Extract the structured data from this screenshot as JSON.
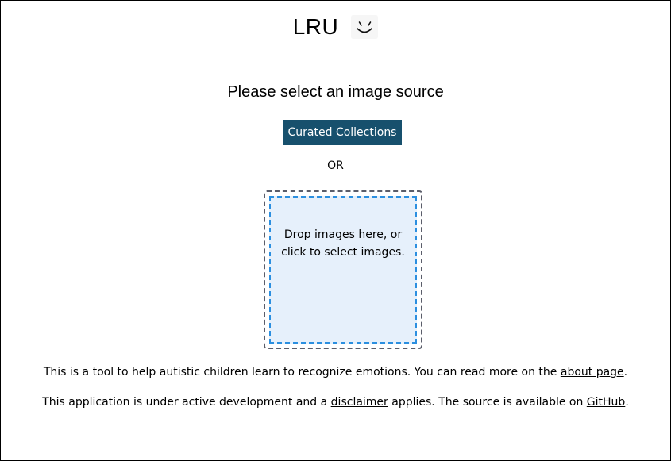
{
  "header": {
    "title": "LRU",
    "logo_icon": "smiley-face-icon"
  },
  "main": {
    "subtitle": "Please select an image source",
    "curated_button_label": "Curated Collections",
    "or_label": "OR",
    "dropzone": {
      "line1": "Drop images here, or",
      "line2": "click to select images."
    }
  },
  "footer": {
    "line1_prefix": "This is a tool to help autistic children learn to recognize emotions. You can read more on the ",
    "line1_link": "about page",
    "line1_suffix": ".",
    "line2_prefix": "This application is under active development and a ",
    "line2_link1": "disclaimer",
    "line2_middle": " applies. The source is available on ",
    "line2_link2": "GitHub",
    "line2_suffix": "."
  },
  "colors": {
    "button_bg": "#17506d",
    "dropzone_fill": "#e6f0fb",
    "dropzone_inner_border": "#2b8fe0",
    "dropzone_outer_border": "#5a5d6a"
  }
}
